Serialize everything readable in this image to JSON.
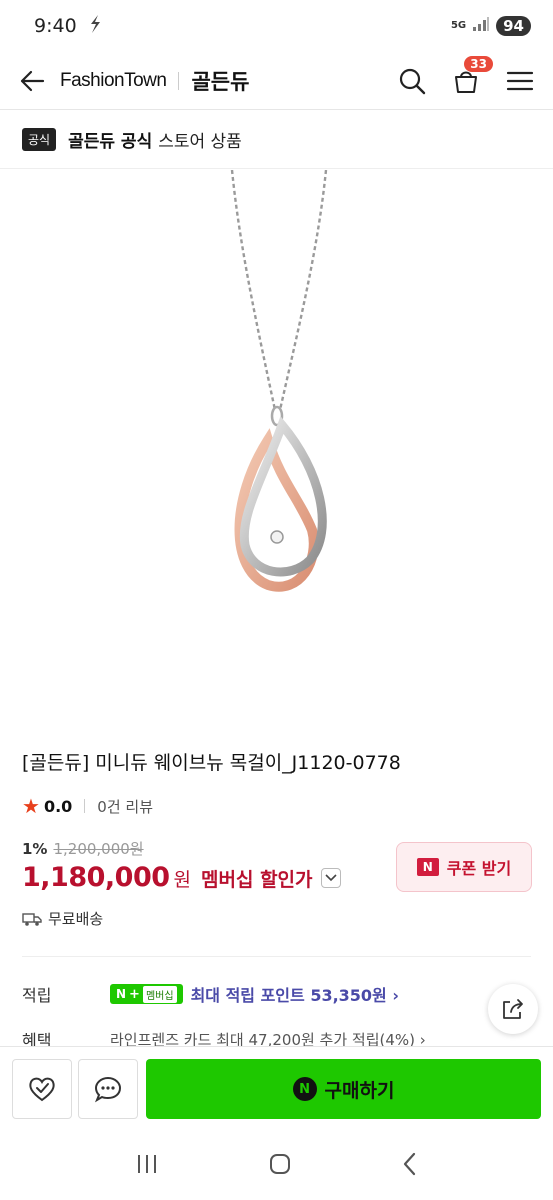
{
  "status_bar": {
    "time": "9:40",
    "network": "5G",
    "battery": "94"
  },
  "header": {
    "brand_name": "FashionTown",
    "brand_sub": "골든듀",
    "cart_count": "33"
  },
  "official": {
    "tag": "공식",
    "store": "골든듀 공식",
    "suffix": "스토어 상품"
  },
  "product": {
    "title": "[골든듀] 미니듀 웨이브뉴 목걸이_J1120-0778",
    "rating": "0.0",
    "reviews": "0건 리뷰",
    "discount_rate": "1%",
    "original_price": "1,200,000원",
    "price": "1,180,000",
    "price_unit": "원",
    "member_discount": "멤버십 할인가",
    "coupon_logo": "N",
    "coupon_label": "쿠폰 받기",
    "shipping": "무료배송"
  },
  "points": {
    "label": "적립",
    "badge_n": "N",
    "badge_plus": "+",
    "badge_text": "멤버십",
    "text": "최대 적립 포인트 53,350원 ›"
  },
  "benefit": {
    "label": "혜택",
    "text": "라인프렌즈 카드 최대 47,200원 추가 적립(4%) ›"
  },
  "bottom_bar": {
    "buy_logo": "N",
    "buy_label": "구매하기"
  },
  "colors": {
    "price_red": "#b8102e",
    "naver_green": "#1ec800",
    "points_blue": "#4a4aa8"
  }
}
